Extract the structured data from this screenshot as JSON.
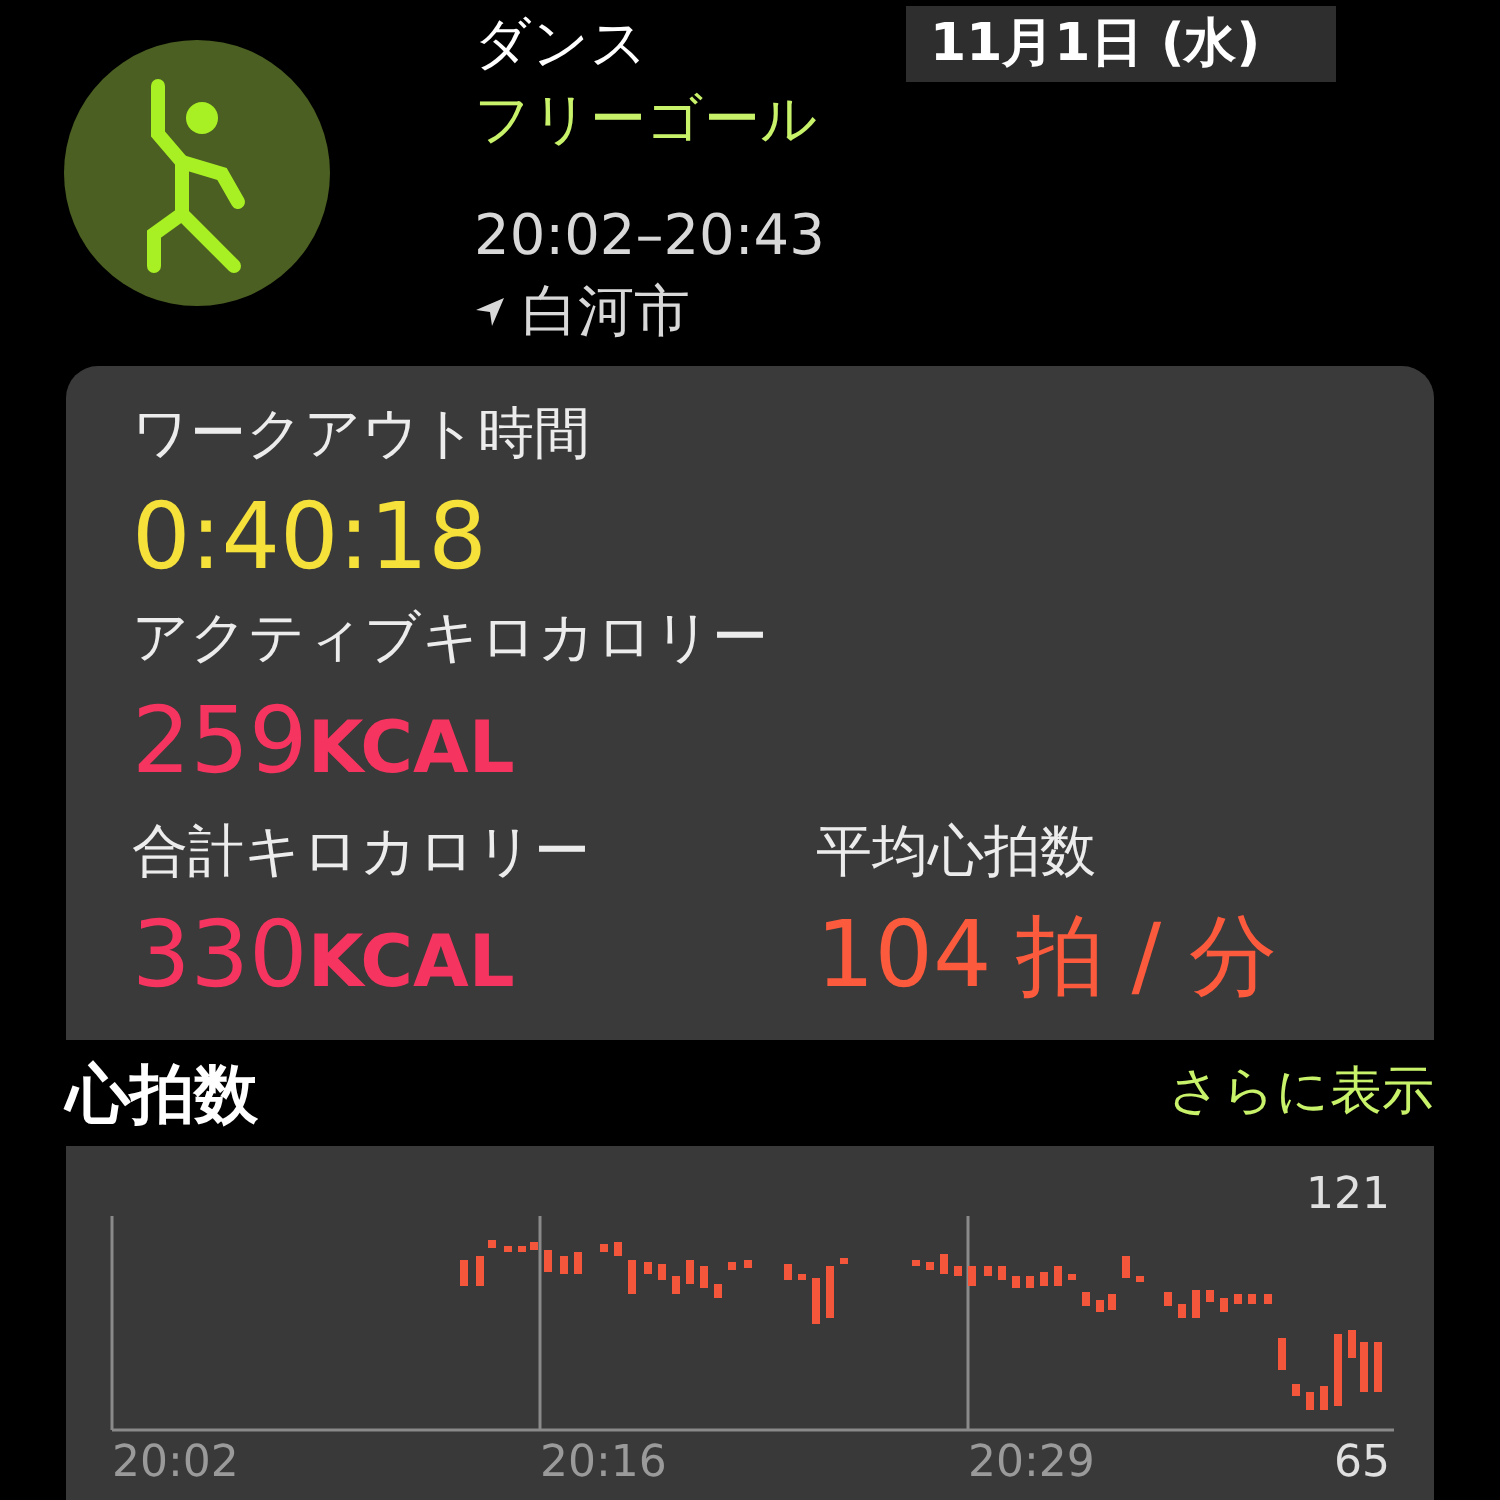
{
  "workout": {
    "type": "ダンス",
    "goal": "フリーゴール",
    "time_range": "20:02–20:43",
    "location": "白河市"
  },
  "date": "11月1日 (水)",
  "summary": [
    {
      "label": "ワークアウト時間",
      "value": "0:40:18",
      "color": "#f5e13a"
    },
    {
      "label": "アクティブキロカロリー",
      "value": "259",
      "unit": "KCAL",
      "color": "#f5355f"
    },
    {
      "label": "合計キロカロリー",
      "value": "330",
      "unit": "KCAL",
      "color": "#f5355f"
    },
    {
      "label": "平均心拍数",
      "value": "104",
      "unit": "拍 / 分",
      "color": "#fb5a3c"
    }
  ],
  "heart_rate": {
    "title": "心拍数",
    "more_link": "さらに表示",
    "max_label": "121",
    "min_label": "65",
    "time_labels": [
      "20:02",
      "20:16",
      "20:29"
    ]
  }
}
